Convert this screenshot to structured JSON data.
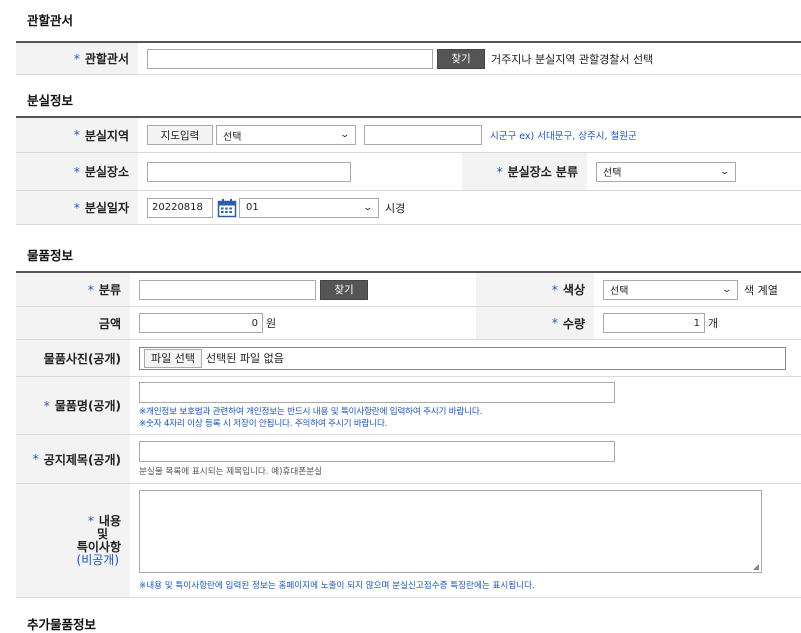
{
  "sections": {
    "jurisdiction": "관할관서",
    "lost_info": "분실정보",
    "item_info": "물품정보",
    "extra_item_info": "추가물품정보"
  },
  "required_mark": "*",
  "jurisdiction": {
    "label": "관할관서",
    "input_value": "",
    "find_button": "찾기",
    "help": "거주지나 분실지역 관할경찰서 선택"
  },
  "lost_area": {
    "label": "분실지역",
    "map_button": "지도입력",
    "select_value": "선택",
    "input_value": "",
    "hint": "시군구 ex) 서대문구, 상주시, 철원군"
  },
  "lost_place": {
    "label": "분실장소",
    "input_value": "",
    "category_label": "분실장소 분류",
    "category_value": "선택"
  },
  "lost_date": {
    "label": "분실일자",
    "date_value": "20220818",
    "hour_value": "01",
    "hour_suffix": "시경"
  },
  "category": {
    "label": "분류",
    "input_value": "",
    "find_button": "찾기"
  },
  "color": {
    "label": "색상",
    "select_value": "선택",
    "suffix": "색 계열"
  },
  "amount": {
    "label": "금액",
    "value": "0",
    "unit": "원"
  },
  "quantity": {
    "label": "수량",
    "value": "1",
    "unit": "개"
  },
  "photo": {
    "label": "물품사진(공개)",
    "file_button": "파일 선택",
    "file_status": "선택된 파일 없음"
  },
  "item_name": {
    "label": "물품명(공개)",
    "input_value": "",
    "note1": "※개인정보 보호법과 관련하여 개인정보는 반드시 내용 및 특이사항란에 입력하여 주시기 바랍니다.",
    "note2": "※숫자 4자리 이상 등록 시 저장이 안됩니다. 주의하여 주시기 바랍니다."
  },
  "notice_title": {
    "label": "공지제목(공개)",
    "input_value": "",
    "hint": "분실물 목록에 표시되는 제목입니다. 예)휴대폰분실"
  },
  "content": {
    "label_line1": "내용",
    "label_line2": "및",
    "label_line3": "특이사항",
    "label_line4": "(비공개)",
    "textarea_value": "",
    "note": "※내용 및 특이사항란에 입력된 정보는 홈페이지에 노출이 되지 않으며 분실신고접수증 특징란에는 표시됩니다."
  },
  "colors": {
    "accent_blue": "#1a56c7",
    "button_dark": "#555555",
    "label_bg": "#f3f3f3"
  }
}
